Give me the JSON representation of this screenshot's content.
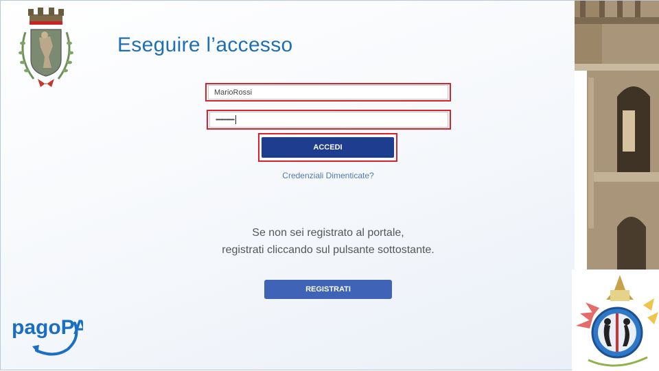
{
  "slide": {
    "title": "Eseguire l’accesso"
  },
  "login": {
    "username_value": "MarioRossi",
    "password_value": "•••••••••••••••",
    "accedi_label": "ACCEDI",
    "forgot_label": "Credenziali Dimenticate?"
  },
  "register": {
    "info_line1": "Se non sei registrato al portale,",
    "info_line2": "registrati cliccando sul pulsante sottostante.",
    "registrati_label": "REGISTRATI"
  },
  "logos": {
    "pagopa_text": "pagoPA"
  },
  "colors": {
    "title": "#1f6fb5",
    "highlight": "#d8222b",
    "accedi_bg": "#1f3d8f",
    "registrati_bg": "#3f63b7",
    "link": "#4e79b5"
  }
}
